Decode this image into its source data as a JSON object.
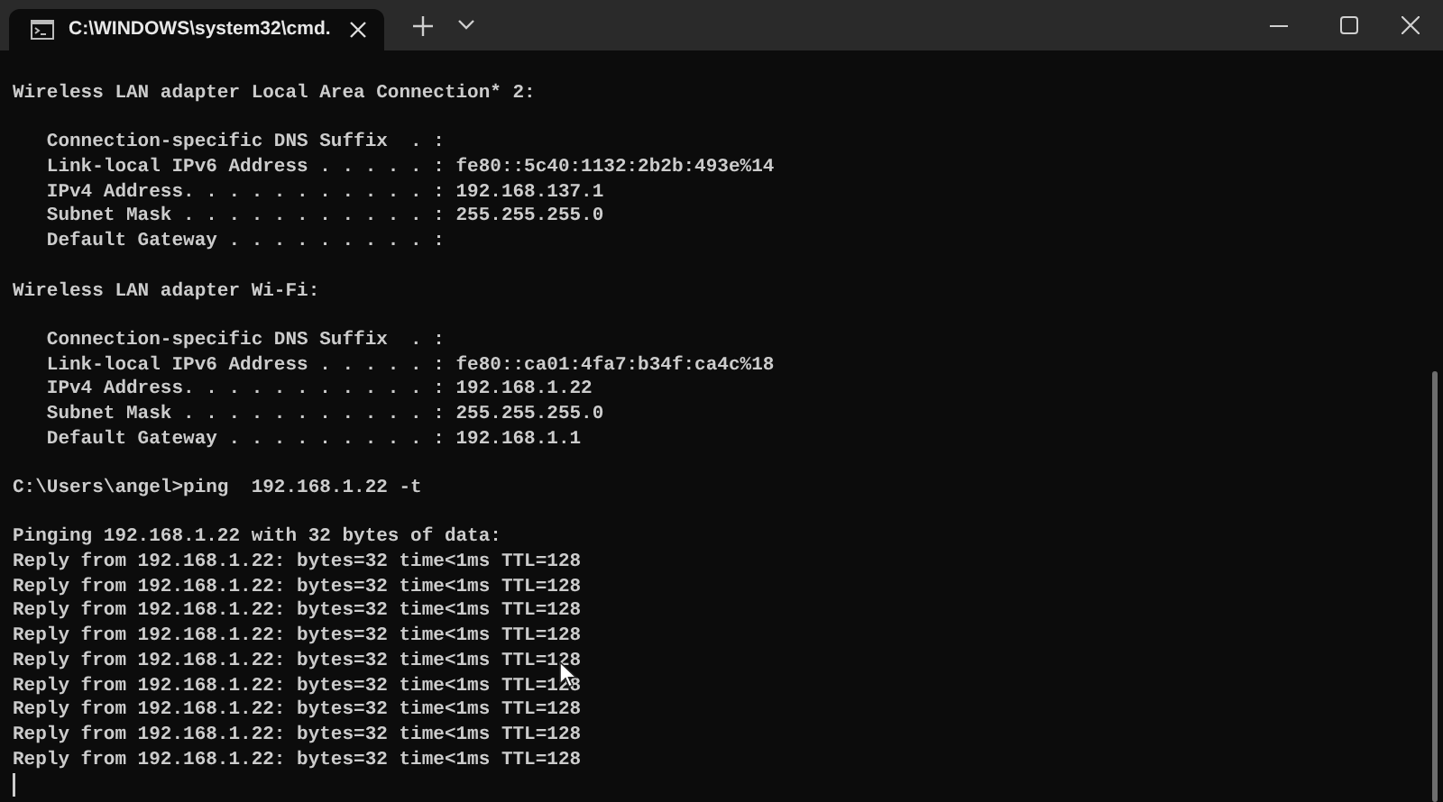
{
  "tabs": [
    {
      "title": "C:\\WINDOWS\\system32\\cmd.",
      "selected": true
    }
  ],
  "output_blocks": [
    {
      "lines": [
        "Wireless LAN adapter Local Area Connection* 2:"
      ]
    },
    {
      "lines": [
        "   Connection-specific DNS Suffix  . :",
        "   Link-local IPv6 Address . . . . . : fe80::5c40:1132:2b2b:493e%14",
        "   IPv4 Address. . . . . . . . . . . : 192.168.137.1",
        "   Subnet Mask . . . . . . . . . . . : 255.255.255.0",
        "   Default Gateway . . . . . . . . . :"
      ]
    },
    {
      "lines": [
        "Wireless LAN adapter Wi-Fi:"
      ]
    },
    {
      "lines": [
        "   Connection-specific DNS Suffix  . :",
        "   Link-local IPv6 Address . . . . . : fe80::ca01:4fa7:b34f:ca4c%18",
        "   IPv4 Address. . . . . . . . . . . : 192.168.1.22",
        "   Subnet Mask . . . . . . . . . . . : 255.255.255.0",
        "   Default Gateway . . . . . . . . . : 192.168.1.1"
      ]
    },
    {
      "lines": [
        "C:\\Users\\angel>ping  192.168.1.22 -t"
      ]
    },
    {
      "lines": [
        "Pinging 192.168.1.22 with 32 bytes of data:",
        "Reply from 192.168.1.22: bytes=32 time<1ms TTL=128",
        "Reply from 192.168.1.22: bytes=32 time<1ms TTL=128",
        "Reply from 192.168.1.22: bytes=32 time<1ms TTL=128",
        "Reply from 192.168.1.22: bytes=32 time<1ms TTL=128",
        "Reply from 192.168.1.22: bytes=32 time<1ms TTL=128",
        "Reply from 192.168.1.22: bytes=32 time<1ms TTL=128",
        "Reply from 192.168.1.22: bytes=32 time<1ms TTL=128",
        "Reply from 192.168.1.22: bytes=32 time<1ms TTL=128",
        "Reply from 192.168.1.22: bytes=32 time<1ms TTL=128"
      ]
    }
  ]
}
